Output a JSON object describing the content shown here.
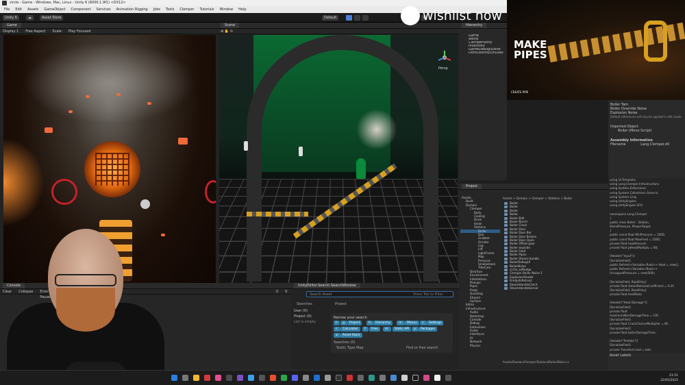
{
  "window": {
    "title": "circle - Game - Windows, Mac, Linux - Unity 6 (6000.1.9f1) <DX12>"
  },
  "menu": [
    "File",
    "Edit",
    "Assets",
    "GameObject",
    "Component",
    "Services",
    "Animation Rigging",
    "Jobs",
    "Tools",
    "Clemper",
    "Tutorials",
    "Window",
    "Help"
  ],
  "toolbar": {
    "account": "Unity 6",
    "layers": "Default",
    "asset_store": "Asset Store"
  },
  "game": {
    "tabs": [
      "Game"
    ],
    "display": "Display 1",
    "aspect": "Free Aspect",
    "scale": "Scale",
    "play_focused": "Play Focused"
  },
  "scene": {
    "tabs": [
      "Scene"
    ],
    "persp": "Persp"
  },
  "hierarchy": {
    "title": "Hierarchy",
    "items": [
      "Game",
      "World",
      "ClemperStory",
      "Inventory",
      "GameDebugScene",
      "DontDestroyOnLoad"
    ]
  },
  "overlay": {
    "brand": "wishlist now",
    "game_title_line1": "MAKE",
    "game_title_line2": "PIPES",
    "studio": "CREATE PIPE"
  },
  "inspector": {
    "rows": [
      "Boiler Tam",
      "Boiler Override Noise",
      "Explosion Noise",
      "Default references will only be applied in edit mode."
    ],
    "imported_object": "Imported Object",
    "script_name": "Boiler (Mono Script)",
    "assembly_title": "Assembly Information",
    "filename_label": "Filename",
    "filename_value": "Lang.Clemper.dll",
    "asset_labels": "Asset Labels"
  },
  "code": [
    "using UI.Template;",
    "using Lang.Clemper.Infrastructure;",
    "using System.Extensions;",
    "using System.Collections.Generic;",
    "using System.Linq;",
    "using UnityEngine;",
    "using UnityEngine.VFX;",
    "",
    "namespace Lang.Clemper",
    "{",
    "  public class Boiler : Station,",
    "  IHandPressure, IPowerTarget",
    "  {",
    "    public const float MinPressure = 1000;",
    "    public const float MaxFeed = 1000;",
    "    private float heatAmount;",
    "    private float ptHeatMultiply = 80;",
    "",
    "    [Header(\"Input\")]",
    "    [SerializeField]",
    "    public Refresh<Variable<float>> Heat = new();",
    "    public Refresh<Variable<float>>",
    "    UncappedPressure = new(500);",
    "",
    "    [SerializeField, ReadOnly]",
    "    private float steamReleaseCoefficient = 0.2f;",
    "    [SerializeField, ReadOnly]",
    "    private float heatRate;",
    "",
    "    [Header(\"Heat Damage\")]",
    "    [SerializeField]",
    "    private float",
    "    maximumNonDamageTime = 10f;",
    "    [SerializeField]",
    "    private float CrackChanceMultiplier = 8f;",
    "    [SerializeField]",
    "    private float boilerDamageTime;",
    "",
    "    [Header(\"Prefabs\")]",
    "    [SerializeField]",
    "    private Transform ball = ball;",
    "    [SerializeField]",
    "    private Transform ball_idle = null;"
  ],
  "project": {
    "title": "Project",
    "breadcrumb": "Assets > Domain > Clemper > Stations > Boiler",
    "path_footer": "Assets/Domain/Clemper/Stations/Boiler/Boiler.cs",
    "tree": [
      "Assets",
      "Build",
      "Domain",
      "Clemper",
      "Body",
      "Cooling",
      "Drain",
      "Seals",
      "Stations",
      "Boiler",
      "Dial",
      "Grabber",
      "Grinder",
      "Leg",
      "Lift",
      "LightFrame",
      "Map",
      "Pressure",
      "Smokestack",
      "TitleCam",
      "Distritue",
      "Environment",
      "Infestations",
      "Pickups",
      "Pipes",
      "Props",
      "Questing",
      "Shared",
      "Surface",
      "Editor",
      "Infrastructure",
      "Audio",
      "Bootstrap",
      "Console",
      "Debug",
      "Extensions",
      "Fields",
      "Interfaces",
      "IO",
      "Network",
      "Physics"
    ],
    "files": [
      "Boiler",
      "Boiler",
      "Boiler",
      "Boiler",
      "Boiler Ball",
      "Boiler Barrel",
      "Boiler Chain",
      "Boiler Door",
      "Boiler Door Bar",
      "Boiler Door Broken",
      "Boiler Door Open",
      "Boiler Offset gear",
      "Boiler explode",
      "Boiler Feed",
      "Boiler Pipes",
      "Boiler Steam Handle",
      "BoilerDebugUI",
      "BoilerNoise",
      "circle_softedge",
      "Clemper Boiler Noise 1",
      "ExplosionShader",
      "FireSpitsRetract",
      "SteamHandleClient",
      "SteamHandleServer"
    ]
  },
  "console": {
    "tab": "Console",
    "buttons": [
      "Clear",
      "Collapse",
      "Error Pause"
    ],
    "counts": [
      "0",
      "0",
      "0"
    ]
  },
  "search": {
    "window_title": "UnityEditor.Search.SearchWindow",
    "placeholder": "Search Asset",
    "hint": "Press Tab to Filter",
    "tabs": [
      "Searches",
      "Project"
    ],
    "sidebar": [
      "User (0)",
      "Project (0)",
      "List is empty"
    ],
    "narrow_label": "Narrow your search",
    "chips": [
      "t:",
      "p:",
      "Project",
      "h:",
      "Hierarchy",
      "m:",
      "Menus",
      "s:",
      "Settings",
      "c:",
      "Calculator",
      "f:",
      "Files",
      "st:",
      "Static API",
      "p:",
      "Packages",
      "a:",
      "Asset Store"
    ],
    "searches_label": "Searches (0)",
    "static_label": "Static Type Map",
    "find_label": "Find or free search"
  },
  "taskbar": {
    "time": "21:51",
    "date": "22/05/2025"
  },
  "colors": {
    "unity_blue": "#4a7fd6",
    "chip_blue": "#2f7fa8",
    "wall_green": "#0b6a32",
    "fire_orange": "#e36a10"
  }
}
